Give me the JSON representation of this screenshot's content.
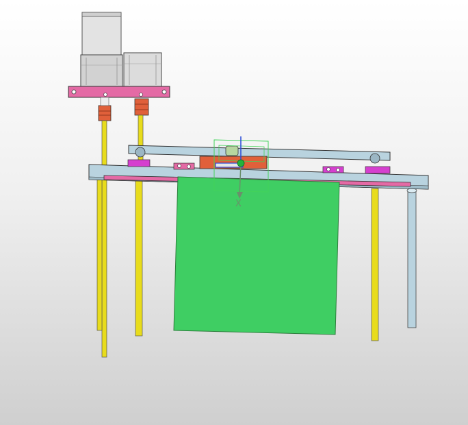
{
  "viewport": {
    "background_top": "#ffffff",
    "background_bottom": "#cfcfcf"
  },
  "colors": {
    "frame_blue": "#b9d3df",
    "frame_pink": "#e46aa5",
    "bracket_orange": "#e0603a",
    "rod_yellow": "#e8dc1c",
    "panel_green": "#3fce63",
    "motor_grey": "#d6d6d6",
    "mount_magenta": "#d53fcf",
    "selection_green": "#42d35a",
    "axis_blue": "#2a4bd8"
  },
  "triad": {
    "x_label": "X"
  }
}
